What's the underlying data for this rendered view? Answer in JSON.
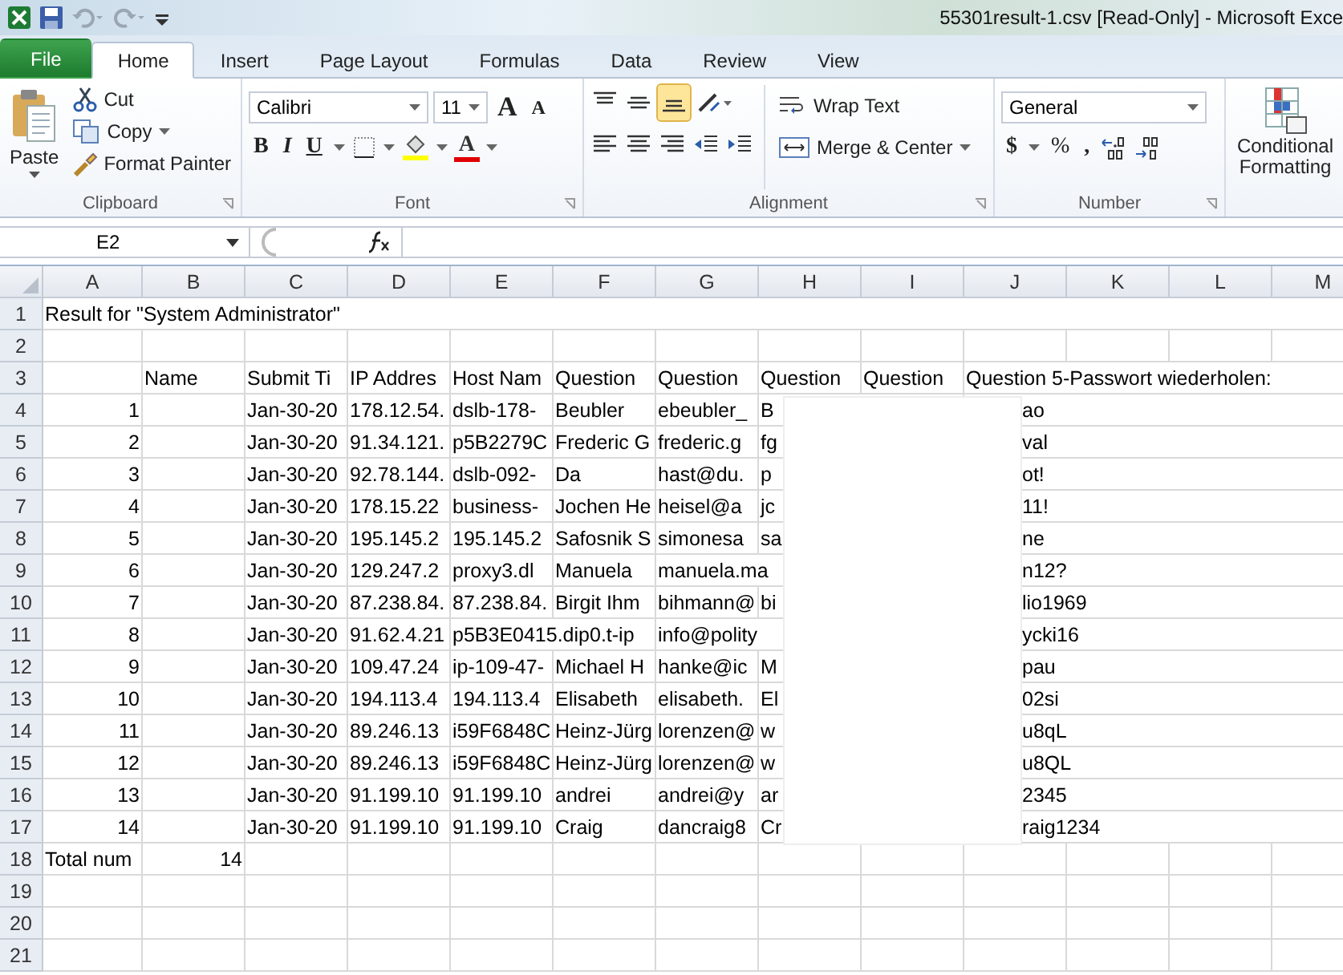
{
  "window": {
    "title": "55301result-1.csv  [Read-Only]  -  Microsoft Exce"
  },
  "tabs": [
    {
      "label": "File",
      "kind": "file",
      "selected": false
    },
    {
      "label": "Home",
      "kind": "tab",
      "selected": true
    },
    {
      "label": "Insert",
      "kind": "tab",
      "selected": false
    },
    {
      "label": "Page Layout",
      "kind": "tab",
      "selected": false
    },
    {
      "label": "Formulas",
      "kind": "tab",
      "selected": false
    },
    {
      "label": "Data",
      "kind": "tab",
      "selected": false
    },
    {
      "label": "Review",
      "kind": "tab",
      "selected": false
    },
    {
      "label": "View",
      "kind": "tab",
      "selected": false
    }
  ],
  "ribbon": {
    "clipboard": {
      "title": "Clipboard",
      "paste": "Paste",
      "cut": "Cut",
      "copy": "Copy",
      "format_painter": "Format Painter"
    },
    "font": {
      "title": "Font",
      "family": "Calibri",
      "size": "11",
      "grow": "A",
      "shrink": "A",
      "bold": "B",
      "italic": "I",
      "underline": "U",
      "font_color": "A"
    },
    "alignment": {
      "title": "Alignment",
      "wrap_text": "Wrap Text",
      "merge_center": "Merge & Center",
      "bottom_align_selected": true
    },
    "number": {
      "title": "Number",
      "format": "General",
      "currency": "$",
      "percent": "%",
      "comma": ","
    },
    "styles": {
      "conditional_formatting": "Conditional Formatting"
    }
  },
  "formula_bar": {
    "name_box": "E2"
  },
  "sheet": {
    "columns": [
      "A",
      "B",
      "C",
      "D",
      "E",
      "F",
      "G",
      "H",
      "I",
      "J",
      "K",
      "L",
      "M"
    ],
    "rows": [
      {
        "number": "1",
        "cells": [
          "Result for \"System Administrator\"",
          "",
          "",
          "",
          "",
          "",
          "",
          "",
          "",
          "",
          "",
          "",
          ""
        ]
      },
      {
        "number": "2",
        "cells": [
          "",
          "",
          "",
          "",
          "",
          "",
          "",
          "",
          "",
          "",
          "",
          "",
          ""
        ]
      },
      {
        "number": "3",
        "cells": [
          "",
          "Name",
          "Submit Ti",
          "IP Addres",
          "Host Nam",
          "Question",
          "Question",
          "Question",
          "Question",
          "Question 5-Passwort wiederholen:",
          "",
          "",
          ""
        ]
      },
      {
        "number": "4",
        "kind": "record",
        "cells": [
          "1",
          "",
          "Jan-30-20",
          "178.12.54.",
          "dslb-178-",
          "Beubler",
          "ebeubler_",
          "B",
          "",
          "ao",
          "",
          "",
          ""
        ]
      },
      {
        "number": "5",
        "kind": "record",
        "cells": [
          "2",
          "",
          "Jan-30-20",
          "91.34.121.",
          "p5B2279C",
          "Frederic G",
          "frederic.g",
          "fg",
          "",
          "val",
          "",
          "",
          ""
        ]
      },
      {
        "number": "6",
        "kind": "record",
        "cells": [
          "3",
          "",
          "Jan-30-20",
          "92.78.144.",
          "dslb-092-",
          "Da",
          "hast@du.",
          "p",
          "",
          "ot!",
          "",
          "",
          ""
        ]
      },
      {
        "number": "7",
        "kind": "record",
        "cells": [
          "4",
          "",
          "Jan-30-20",
          "178.15.22",
          "business-",
          "Jochen He",
          "heisel@a",
          "jc",
          "",
          "11!",
          "",
          "",
          ""
        ]
      },
      {
        "number": "8",
        "kind": "record",
        "cells": [
          "5",
          "",
          "Jan-30-20",
          "195.145.2",
          "195.145.2",
          "Safosnik S",
          "simonesa",
          "sa",
          "",
          "ne",
          "",
          "",
          ""
        ]
      },
      {
        "number": "9",
        "kind": "record",
        "cells": [
          "6",
          "",
          "Jan-30-20",
          "129.247.2",
          "proxy3.dl",
          "Manuela",
          "manuela.ma",
          "",
          "",
          "n12?",
          "",
          "",
          ""
        ]
      },
      {
        "number": "10",
        "kind": "record",
        "cells": [
          "7",
          "",
          "Jan-30-20",
          "87.238.84.",
          "87.238.84.",
          "Birgit Ihm",
          "bihmann@",
          "bi",
          "",
          "lio1969",
          "",
          "",
          ""
        ]
      },
      {
        "number": "11",
        "kind": "record",
        "cells": [
          "8",
          "",
          "Jan-30-20",
          "91.62.4.21",
          "p5B3E0415.dip0.t-ip",
          "",
          "info@polity",
          "",
          "",
          "ycki16",
          "",
          "",
          ""
        ]
      },
      {
        "number": "12",
        "kind": "record",
        "cells": [
          "9",
          "",
          "Jan-30-20",
          "109.47.24",
          "ip-109-47-",
          "Michael H",
          "hanke@ic",
          "M",
          "",
          "pau",
          "",
          "",
          ""
        ]
      },
      {
        "number": "13",
        "kind": "record",
        "cells": [
          "10",
          "",
          "Jan-30-20",
          "194.113.4",
          "194.113.4",
          "Elisabeth",
          "elisabeth.",
          "El",
          "",
          "02si",
          "",
          "",
          ""
        ]
      },
      {
        "number": "14",
        "kind": "record",
        "cells": [
          "11",
          "",
          "Jan-30-20",
          "89.246.13",
          "i59F6848C",
          "Heinz-Jürg",
          "lorenzen@",
          "w",
          "",
          "u8qL",
          "",
          "",
          ""
        ]
      },
      {
        "number": "15",
        "kind": "record",
        "cells": [
          "12",
          "",
          "Jan-30-20",
          "89.246.13",
          "i59F6848C",
          "Heinz-Jürg",
          "lorenzen@",
          "w",
          "",
          "u8QL",
          "",
          "",
          ""
        ]
      },
      {
        "number": "16",
        "kind": "record",
        "cells": [
          "13",
          "",
          "Jan-30-20",
          "91.199.10",
          "91.199.10",
          "andrei",
          "andrei@y",
          "ar",
          "",
          "2345",
          "",
          "",
          ""
        ]
      },
      {
        "number": "17",
        "kind": "record",
        "cells": [
          "14",
          "",
          "Jan-30-20",
          "91.199.10",
          "91.199.10",
          "Craig",
          "dancraig8",
          "Cr",
          "",
          "raig1234",
          "",
          "",
          ""
        ]
      },
      {
        "number": "18",
        "kind": "total",
        "cells": [
          "Total num",
          "14",
          "",
          "",
          "",
          "",
          "",
          "",
          "",
          "",
          "",
          "",
          ""
        ]
      },
      {
        "number": "19",
        "cells": [
          "",
          "",
          "",
          "",
          "",
          "",
          "",
          "",
          "",
          "",
          "",
          "",
          ""
        ]
      },
      {
        "number": "20",
        "cells": [
          "",
          "",
          "",
          "",
          "",
          "",
          "",
          "",
          "",
          "",
          "",
          "",
          ""
        ]
      },
      {
        "number": "21",
        "cells": [
          "",
          "",
          "",
          "",
          "",
          "",
          "",
          "",
          "",
          "",
          "",
          "",
          ""
        ]
      }
    ]
  }
}
